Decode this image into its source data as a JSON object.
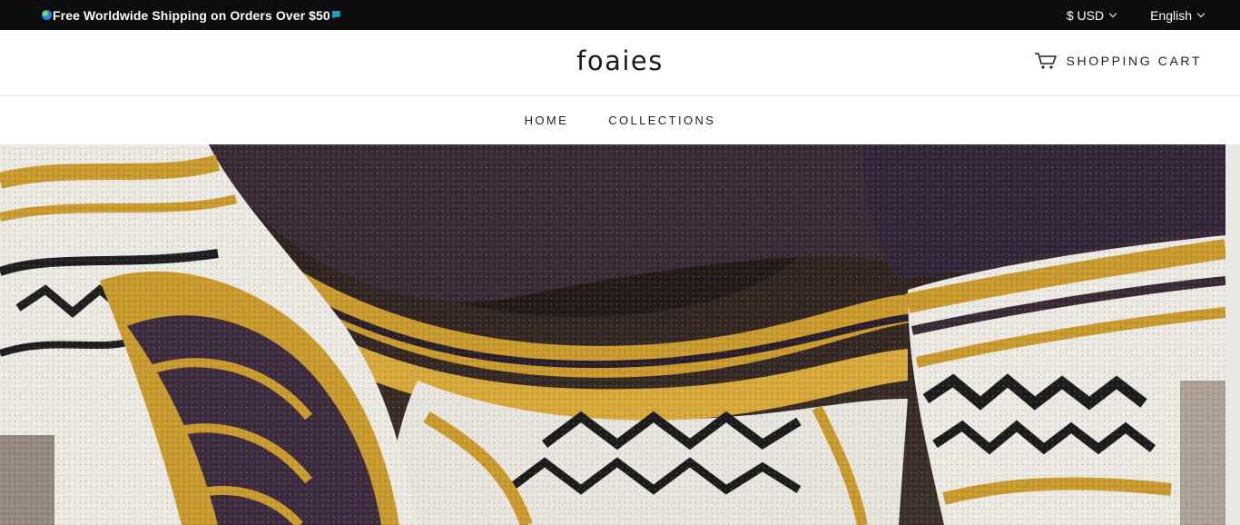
{
  "announcement": {
    "message": "Free Worldwide Shipping on Orders Over $50",
    "leading_icon": "globe-icon",
    "trailing_icon": "flag-icon"
  },
  "currency_selector": {
    "value": "$ USD"
  },
  "language_selector": {
    "value": "English"
  },
  "header": {
    "logo": "foaies",
    "cart_label": "SHOPPING CART",
    "cart_icon": "cart-icon"
  },
  "nav": {
    "items": [
      {
        "label": "HOME"
      },
      {
        "label": "COLLECTIONS"
      }
    ]
  },
  "colors": {
    "announcement_bg": "#0d0d0d",
    "text_dark": "#1a1a1a",
    "hero_mustard": "#c99a2e",
    "hero_purple": "#3b2a3a"
  }
}
